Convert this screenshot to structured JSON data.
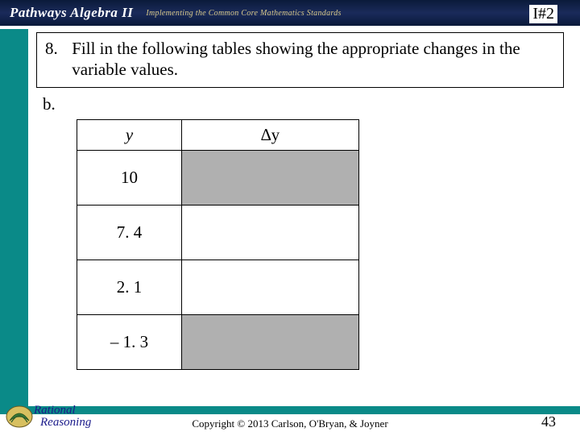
{
  "header": {
    "title_main": "Pathways Algebra II",
    "subtitle": "Implementing the Common Core Mathematics Standards",
    "code": "I#2"
  },
  "problem": {
    "number": "8.",
    "text": "Fill in the following tables showing the appropriate changes in the variable values.",
    "sub_label": "b."
  },
  "table": {
    "head_y": "y",
    "head_dy": "∆y",
    "rows": [
      {
        "y": "10",
        "shaded": true
      },
      {
        "y": "7. 4",
        "shaded": false
      },
      {
        "y": "2. 1",
        "shaded": false
      },
      {
        "y": "– 1. 3",
        "shaded": true
      }
    ]
  },
  "footer": {
    "copyright": "Copyright © 2013 Carlson, O'Bryan, & Joyner",
    "page": "43",
    "logo_top": "Rational",
    "logo_bottom": "Reasoning"
  }
}
